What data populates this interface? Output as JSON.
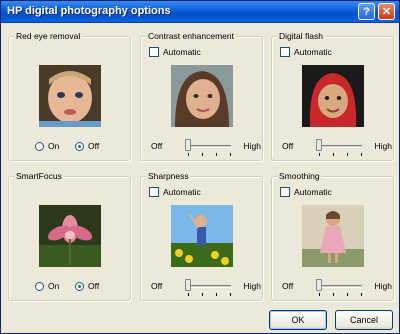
{
  "window": {
    "title": "HP digital photography options"
  },
  "titlebar": {
    "help_icon": "?",
    "close_icon": "✕"
  },
  "groups": {
    "red_eye": {
      "label": "Red eye removal",
      "radio_on": "On",
      "radio_off": "Off",
      "selected": "Off"
    },
    "contrast": {
      "label": "Contrast enhancement",
      "checkbox": "Automatic",
      "slider_low": "Off",
      "slider_high": "High",
      "level": 0
    },
    "flash": {
      "label": "Digital flash",
      "checkbox": "Automatic",
      "slider_low": "Off",
      "slider_high": "High",
      "level": 0
    },
    "smartfocus": {
      "label": "SmartFocus",
      "radio_on": "On",
      "radio_off": "Off",
      "selected": "Off"
    },
    "sharpness": {
      "label": "Sharpness",
      "checkbox": "Automatic",
      "slider_low": "Off",
      "slider_high": "High",
      "level": 0
    },
    "smoothing": {
      "label": "Smoothing",
      "checkbox": "Automatic",
      "slider_low": "Off",
      "slider_high": "High",
      "level": 0
    }
  },
  "buttons": {
    "ok": "OK",
    "cancel": "Cancel"
  },
  "colors": {
    "titlebar": "#0a5fd8",
    "window_bg": "#ece9d8",
    "close_button": "#c43c14"
  }
}
